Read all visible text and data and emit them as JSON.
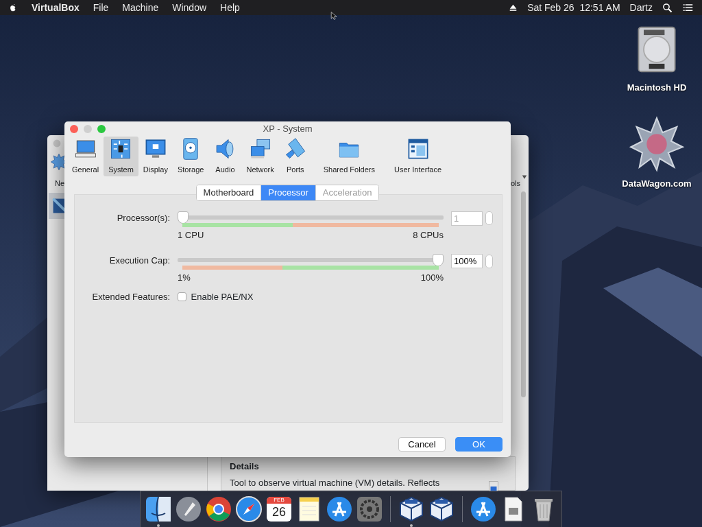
{
  "menu_bar": {
    "app": "VirtualBox",
    "menus": [
      "File",
      "Machine",
      "Window",
      "Help"
    ],
    "clock": "Sat Feb 26  12:51 AM",
    "user": "Dartz"
  },
  "desktop_icons": [
    {
      "kind": "disk",
      "label": "Macintosh HD"
    },
    {
      "kind": "star",
      "label": "DataWagon.com"
    }
  ],
  "background_window": {
    "toolbar_left": "Ne",
    "toolbar_right": "ols",
    "details_title": "Details",
    "details_text": "Tool to observe virtual machine (VM) details. Reflects"
  },
  "dialog": {
    "title": "XP - System",
    "categories": [
      {
        "kind": "general",
        "label": "General",
        "selected": false
      },
      {
        "kind": "system",
        "label": "System",
        "selected": true
      },
      {
        "kind": "display",
        "label": "Display",
        "selected": false
      },
      {
        "kind": "storage",
        "label": "Storage",
        "selected": false
      },
      {
        "kind": "audio",
        "label": "Audio",
        "selected": false
      },
      {
        "kind": "network",
        "label": "Network",
        "selected": false
      },
      {
        "kind": "ports",
        "label": "Ports",
        "selected": false
      },
      {
        "kind": "folders",
        "label": "Shared Folders",
        "selected": false
      },
      {
        "kind": "ui",
        "label": "User Interface",
        "selected": false
      }
    ],
    "tabs": [
      {
        "label": "Motherboard",
        "selected": false,
        "disabled": false
      },
      {
        "label": "Processor",
        "selected": true,
        "disabled": false
      },
      {
        "label": "Acceleration",
        "selected": false,
        "disabled": true
      }
    ],
    "sliders": [
      {
        "label": "Processor(s):",
        "level": 0,
        "min_label": "1 CPU",
        "max_label": "8 CPUs",
        "value": "1",
        "disabled": true,
        "scale": {
          "color": "#f0b9a0",
          "fill": {
            "color": "#a8e3a4",
            "level": 0.43
          }
        }
      },
      {
        "label": "Execution Cap:",
        "level": 1,
        "min_label": "1%",
        "max_label": "100%",
        "value": "100%",
        "disabled": false,
        "scale": {
          "color": "#a8e3a4",
          "fill": {
            "color": "#f0b9a0",
            "level": 0.39
          }
        }
      }
    ],
    "extended_features": {
      "label": "Extended Features:",
      "option": "Enable PAE/NX",
      "checked": false
    },
    "buttons": [
      {
        "label": "Cancel",
        "default": false
      },
      {
        "label": "OK",
        "default": true
      }
    ]
  },
  "dock": [
    {
      "kind": "finder",
      "running": true
    },
    {
      "kind": "launchpad"
    },
    {
      "kind": "chrome"
    },
    {
      "kind": "safari"
    },
    {
      "kind": "calendar",
      "month": "FEB",
      "day": "26"
    },
    {
      "kind": "notes"
    },
    {
      "kind": "appstore"
    },
    {
      "kind": "settings"
    },
    {
      "kind": "separator"
    },
    {
      "kind": "virtualbox",
      "running": true
    },
    {
      "kind": "virtualbox"
    },
    {
      "kind": "separator"
    },
    {
      "kind": "appstore"
    },
    {
      "kind": "file"
    },
    {
      "kind": "trash"
    }
  ]
}
